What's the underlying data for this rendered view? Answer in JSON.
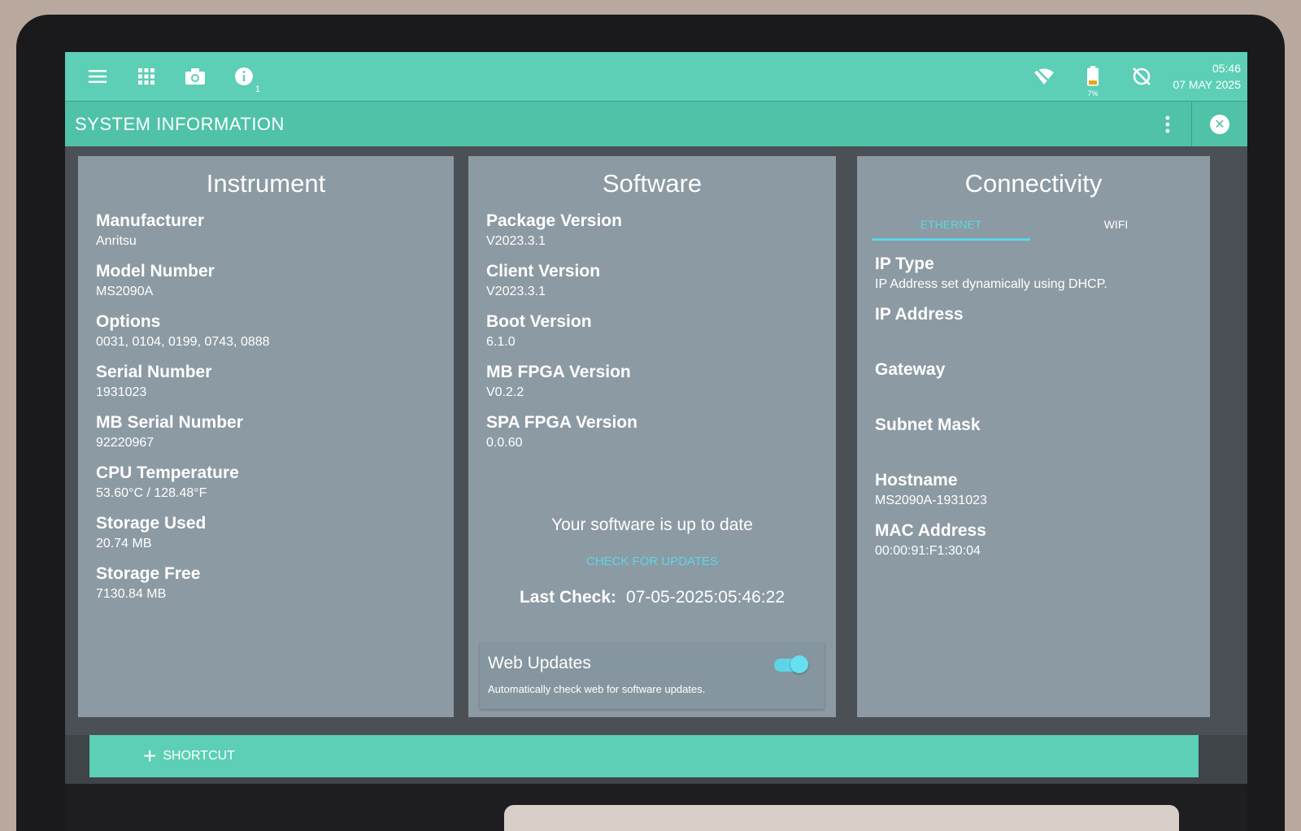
{
  "status_bar": {
    "icons": [
      "menu-icon",
      "apps-grid-icon",
      "camera-icon",
      "info-icon",
      "wifi-off-icon",
      "battery-icon",
      "sync-disabled-icon"
    ],
    "info_badge": "1",
    "battery_pct": "7%",
    "time": "05:46",
    "date": "07 MAY 2025"
  },
  "title_bar": {
    "title": "SYSTEM INFORMATION"
  },
  "instrument": {
    "heading": "Instrument",
    "fields": [
      {
        "label": "Manufacturer",
        "value": "Anritsu"
      },
      {
        "label": "Model Number",
        "value": "MS2090A"
      },
      {
        "label": "Options",
        "value": "0031, 0104, 0199, 0743, 0888"
      },
      {
        "label": "Serial Number",
        "value": "1931023"
      },
      {
        "label": "MB Serial Number",
        "value": "92220967"
      },
      {
        "label": "CPU Temperature",
        "value": "53.60°C / 128.48°F"
      },
      {
        "label": "Storage Used",
        "value": "20.74 MB"
      },
      {
        "label": "Storage Free",
        "value": "7130.84 MB"
      }
    ]
  },
  "software": {
    "heading": "Software",
    "fields": [
      {
        "label": "Package Version",
        "value": "V2023.3.1"
      },
      {
        "label": "Client Version",
        "value": "V2023.3.1"
      },
      {
        "label": "Boot Version",
        "value": "6.1.0"
      },
      {
        "label": "MB FPGA Version",
        "value": "V0.2.2"
      },
      {
        "label": "SPA FPGA Version",
        "value": "0.0.60"
      }
    ],
    "status": "Your software is up to date",
    "check_link": "CHECK FOR UPDATES",
    "last_check_label": "Last Check:",
    "last_check_value": "07-05-2025:05:46:22",
    "web_updates_title": "Web Updates",
    "web_updates_desc": "Automatically check web for software updates.",
    "web_updates_enabled": true
  },
  "connectivity": {
    "heading": "Connectivity",
    "tabs": [
      "ETHERNET",
      "WIFI"
    ],
    "active_tab": "ETHERNET",
    "fields": [
      {
        "label": "IP Type",
        "value": "IP Address set dynamically using DHCP."
      },
      {
        "label": "IP Address",
        "value": ""
      },
      {
        "label": "Gateway",
        "value": ""
      },
      {
        "label": "Subnet Mask",
        "value": ""
      },
      {
        "label": "Hostname",
        "value": "MS2090A-1931023"
      },
      {
        "label": "MAC Address",
        "value": "00:00:91:F1:30:04"
      }
    ]
  },
  "bottom_bar": {
    "shortcut_label": "SHORTCUT"
  },
  "colors": {
    "accent": "#5ccfb6",
    "panel": "#8c9aa3",
    "link": "#5cd6e6"
  }
}
